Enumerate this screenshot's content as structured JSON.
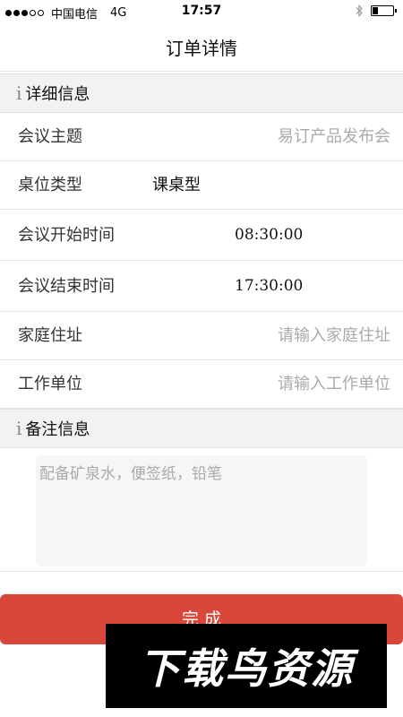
{
  "status_bar": {
    "carrier": "中国电信",
    "network": "4G",
    "time": "17:57",
    "battery_level": 0.3,
    "signal_bars_filled": 3,
    "signal_bars_total": 5
  },
  "nav": {
    "title": "订单详情"
  },
  "detail_section": {
    "icon": "i",
    "title": "详细信息",
    "fields": [
      {
        "label": "会议主题",
        "value": "易订产品发布会"
      },
      {
        "label": "桌位类型",
        "value": "课桌型"
      },
      {
        "label": "会议开始时间",
        "value": "08:30:00"
      },
      {
        "label": "会议结束时间",
        "value": "17:30:00"
      },
      {
        "label": "家庭住址",
        "placeholder": "请输入家庭住址"
      },
      {
        "label": "工作单位",
        "placeholder": "请输入工作单位"
      }
    ]
  },
  "remark_section": {
    "icon": "i",
    "title": "备注信息",
    "placeholder": "配备矿泉水，便签纸，铅笔"
  },
  "submit": {
    "label": "完 成"
  },
  "watermark": {
    "text": "下载鸟资源"
  },
  "colors": {
    "accent": "#d9473a",
    "section_bg": "#f2f2f2",
    "placeholder": "#aaaaaa"
  }
}
